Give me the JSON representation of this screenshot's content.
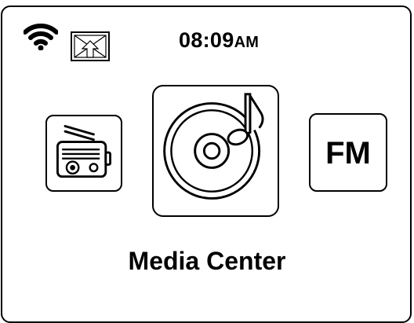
{
  "status_bar": {
    "wifi_icon": "wifi-icon",
    "usb_icon": "usb-icon",
    "time": "08:09",
    "ampm": "AM"
  },
  "menu": {
    "items": [
      {
        "icon": "radio-icon"
      },
      {
        "icon": "music-disc-icon",
        "selected": true
      },
      {
        "label": "FM"
      }
    ],
    "selected_title": "Media Center"
  }
}
